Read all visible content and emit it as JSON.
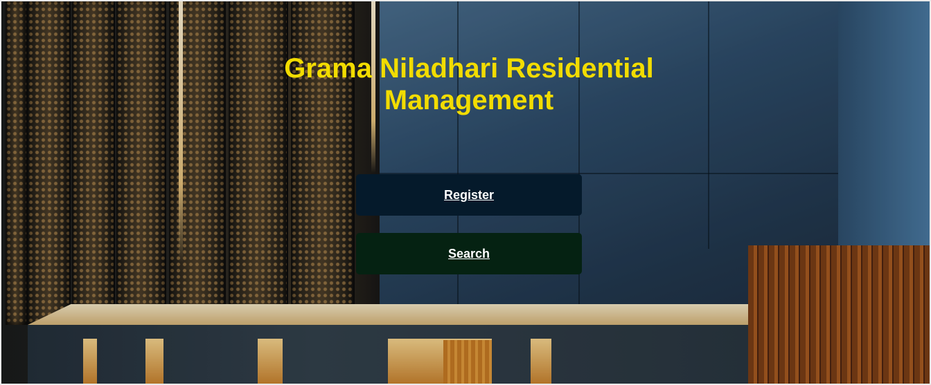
{
  "page": {
    "title": "Grama Niladhari Residential Management",
    "background": "building-facade-photo"
  },
  "actions": {
    "register_label": "Register",
    "search_label": "Search"
  },
  "colors": {
    "title": "#f2dc00",
    "register_button": "#051a2b",
    "search_button": "#052212",
    "button_text": "#ffffff"
  }
}
